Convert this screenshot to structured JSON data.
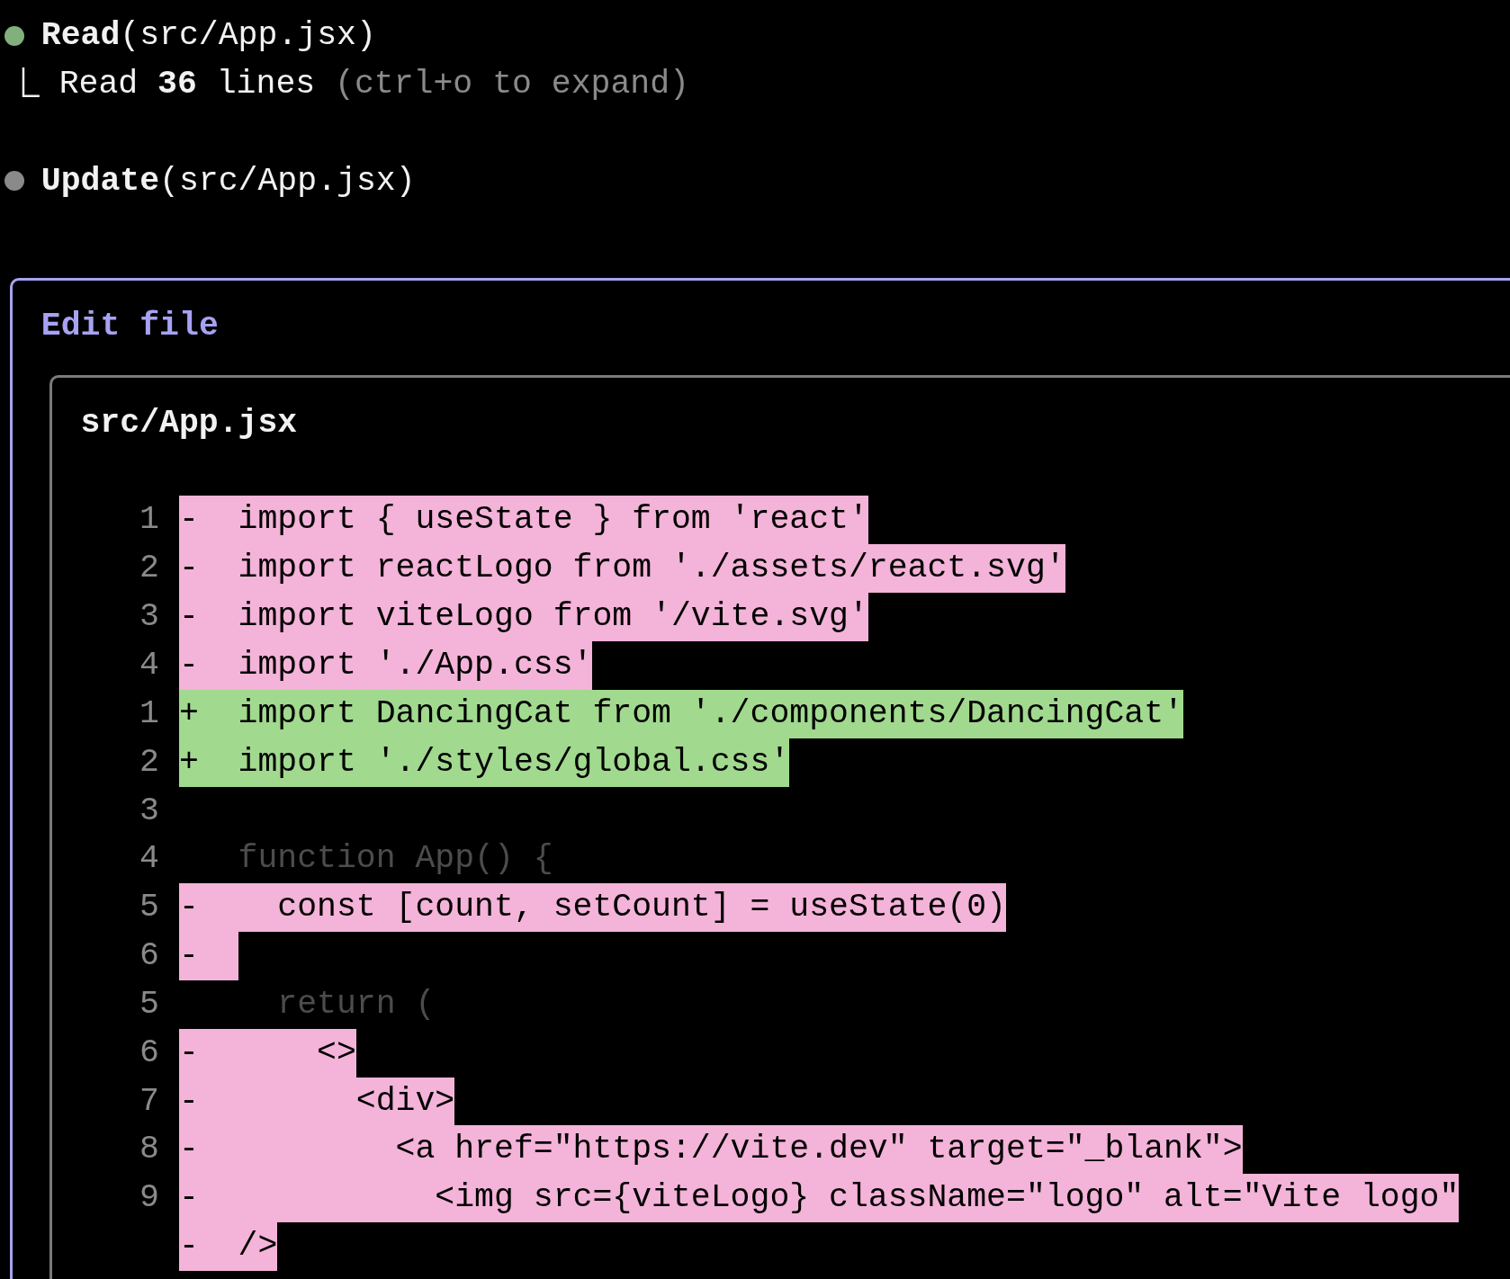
{
  "tool_calls": [
    {
      "title": "**Read**(src/App.jsx)",
      "color": "#82b07c",
      "result": {
        "summary": "Read **36** lines",
        "hint": "(ctrl+o to expand)"
      }
    },
    {
      "title": "**Update**(src/App.jsx)",
      "color": "#8a8a8a"
    }
  ],
  "edit_panel": {
    "title": "Edit file",
    "file": {
      "path": "src/App.jsx",
      "lines": [
        {
          "number": "1",
          "kind": "removed",
          "marker": "-",
          "text": "import { useState } from 'react'"
        },
        {
          "number": "2",
          "kind": "removed",
          "marker": "-",
          "text": "import reactLogo from './assets/react.svg'"
        },
        {
          "number": "3",
          "kind": "removed",
          "marker": "-",
          "text": "import viteLogo from '/vite.svg'"
        },
        {
          "number": "4",
          "kind": "removed",
          "marker": "-",
          "text": "import './App.css'"
        },
        {
          "number": "1",
          "kind": "added",
          "marker": "+",
          "text": "import DancingCat from './components/DancingCat'"
        },
        {
          "number": "2",
          "kind": "added",
          "marker": "+",
          "text": "import './styles/global.css'"
        },
        {
          "number": "3",
          "kind": "context"
        },
        {
          "number": "4",
          "kind": "context",
          "text": "function App() {"
        },
        {
          "number": "5",
          "kind": "removed",
          "marker": "-",
          "text": "  const [count, setCount] = useState(0)"
        },
        {
          "number": "6",
          "kind": "removed",
          "marker": "-"
        },
        {
          "number": "5",
          "kind": "context",
          "text": "  return ("
        },
        {
          "number": "6",
          "kind": "removed",
          "marker": "-",
          "text": "    <>"
        },
        {
          "number": "7",
          "kind": "removed",
          "marker": "-",
          "text": "      <div>"
        },
        {
          "number": "8",
          "kind": "removed",
          "marker": "-",
          "text": "        <a href=\"https://vite.dev\" target=\"_blank\">"
        },
        {
          "number": "9",
          "kind": "removed",
          "marker": "-",
          "text": "          <img src={viteLogo} className=\"logo\" alt=\"Vite logo\""
        },
        {
          "kind": "removed",
          "marker": "-",
          "text": "/>"
        }
      ]
    }
  }
}
